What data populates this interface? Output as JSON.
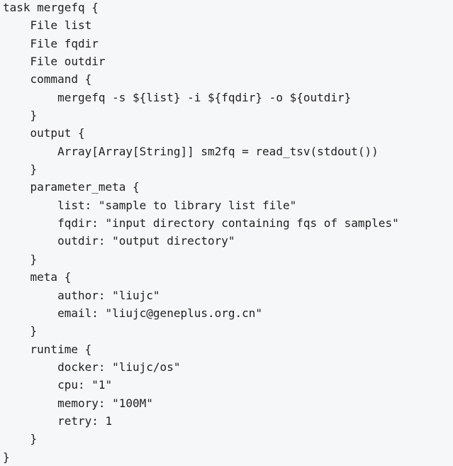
{
  "code": {
    "lines": [
      "task mergefq {",
      "    File list",
      "    File fqdir",
      "    File outdir",
      "    command {",
      "        mergefq -s ${list} -i ${fqdir} -o ${outdir}",
      "    }",
      "    output {",
      "        Array[Array[String]] sm2fq = read_tsv(stdout())",
      "    }",
      "    parameter_meta {",
      "        list: \"sample to library list file\"",
      "        fqdir: \"input directory containing fqs of samples\"",
      "        outdir: \"output directory\"",
      "    }",
      "    meta {",
      "        author: \"liujc\"",
      "        email: \"liujc@geneplus.org.cn\"",
      "    }",
      "    runtime {",
      "        docker: \"liujc/os\"",
      "        cpu: \"1\"",
      "        memory: \"100M\"",
      "        retry: 1",
      "    }",
      "}"
    ]
  }
}
